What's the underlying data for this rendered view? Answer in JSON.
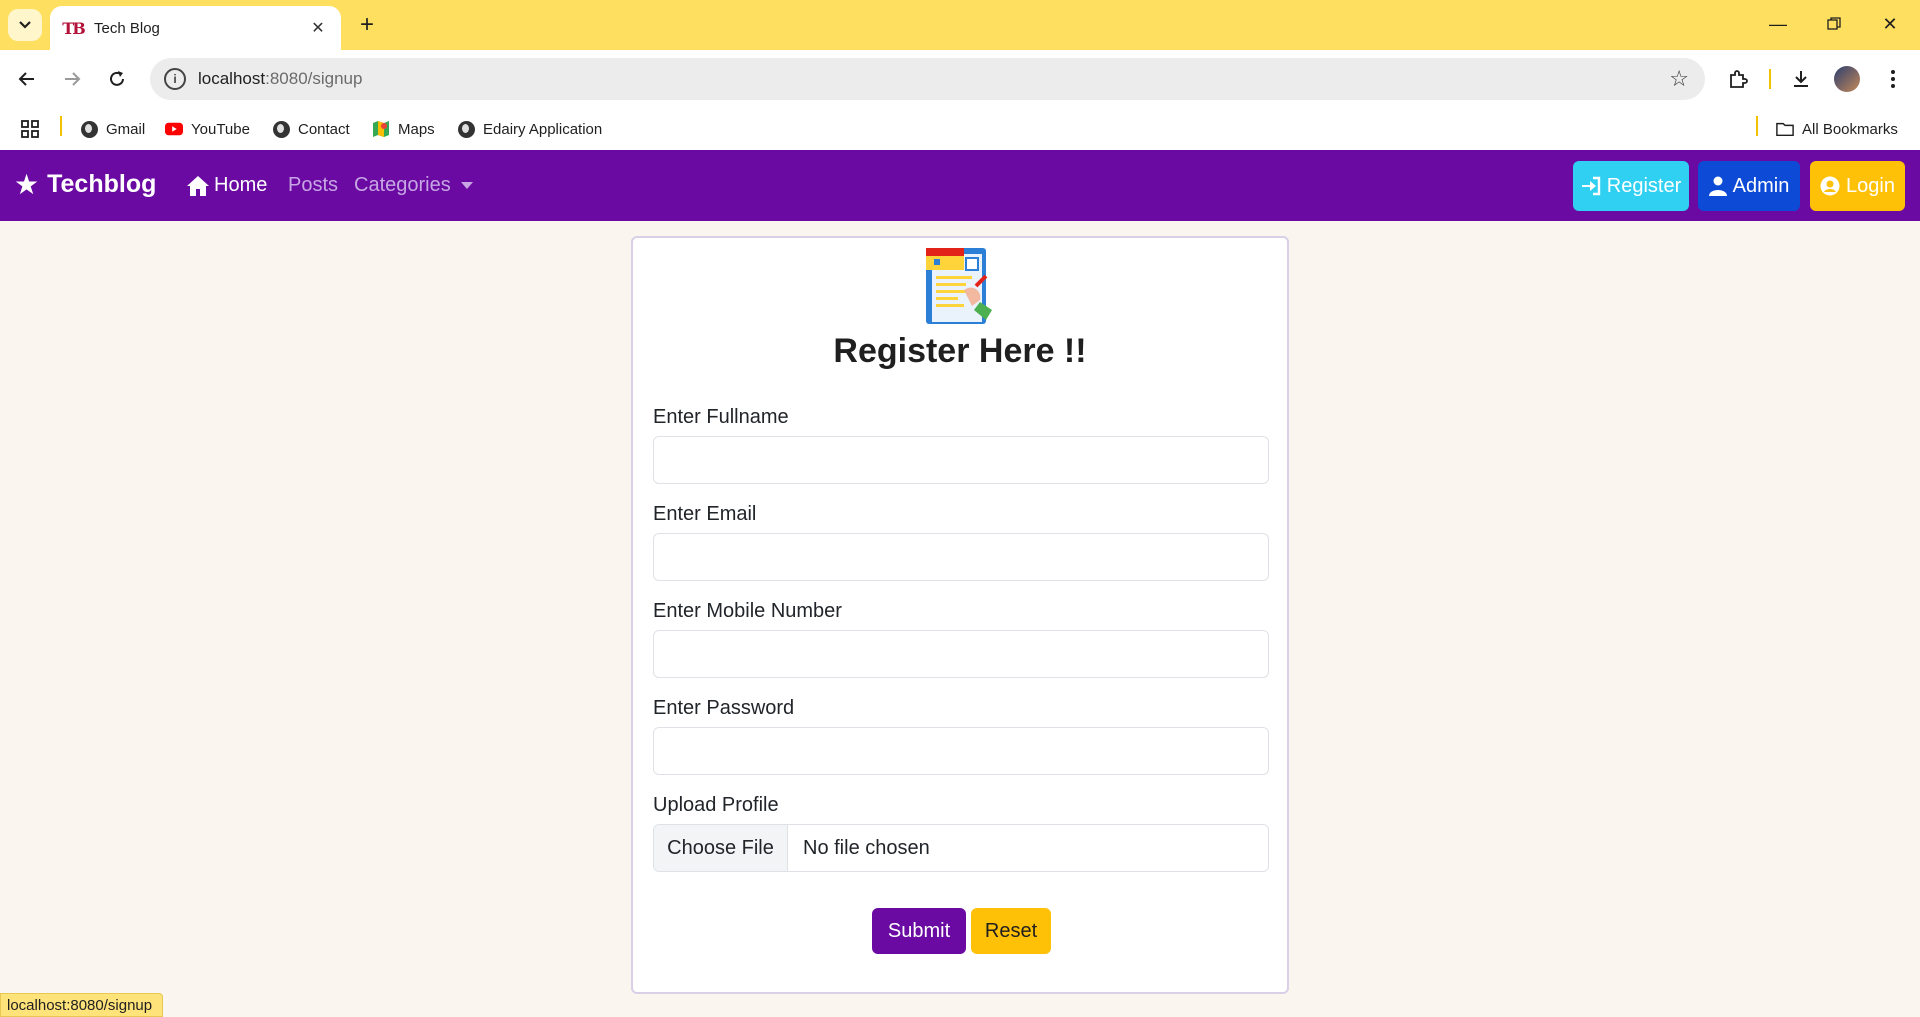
{
  "browser": {
    "tab_title": "Tech Blog",
    "tab_favicon_text": "TB",
    "url_host": "localhost",
    "url_rest": ":8080/signup",
    "bookmarks": [
      {
        "label": "Gmail",
        "icon": "globe-icon"
      },
      {
        "label": "YouTube",
        "icon": "youtube-icon"
      },
      {
        "label": "Contact",
        "icon": "globe-icon"
      },
      {
        "label": "Maps",
        "icon": "maps-icon"
      },
      {
        "label": "Edairy Application",
        "icon": "globe-icon"
      }
    ],
    "all_bookmarks": "All Bookmarks",
    "status_url": "localhost:8080/signup"
  },
  "navbar": {
    "brand": "Techblog",
    "links": {
      "home": "Home",
      "posts": "Posts",
      "categories": "Categories"
    },
    "buttons": {
      "register": "Register",
      "admin": "Admin",
      "login": "Login"
    },
    "colors": {
      "bg": "#6a0aa3",
      "register": "#2fd0f2",
      "admin": "#0d4bd6",
      "login": "#ffc107"
    }
  },
  "form": {
    "title": "Register Here !!",
    "fields": {
      "fullname": {
        "label": "Enter Fullname",
        "value": ""
      },
      "email": {
        "label": "Enter Email",
        "value": ""
      },
      "mobile": {
        "label": "Enter Mobile Number",
        "value": ""
      },
      "password": {
        "label": "Enter Password",
        "value": ""
      }
    },
    "upload": {
      "label": "Upload Profile",
      "button": "Choose File",
      "status": "No file chosen"
    },
    "submit": "Submit",
    "reset": "Reset"
  }
}
